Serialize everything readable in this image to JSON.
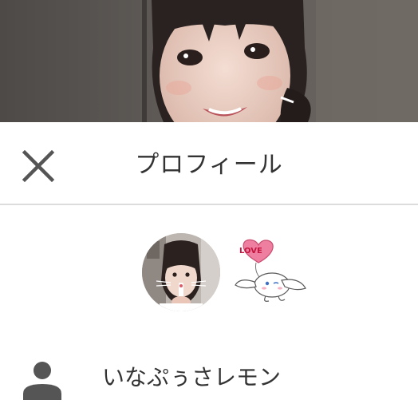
{
  "header": {
    "title": "プロフィール"
  },
  "profile": {
    "display_name": "いなぷぅさレモン",
    "sticker_text": "LOVE"
  },
  "icons": {
    "close": "close-icon",
    "person": "person-icon"
  },
  "colors": {
    "title_text": "#333333",
    "icon_gray": "#555555",
    "divider": "#dcdcdc",
    "heart_pink": "#ef7fa0"
  }
}
